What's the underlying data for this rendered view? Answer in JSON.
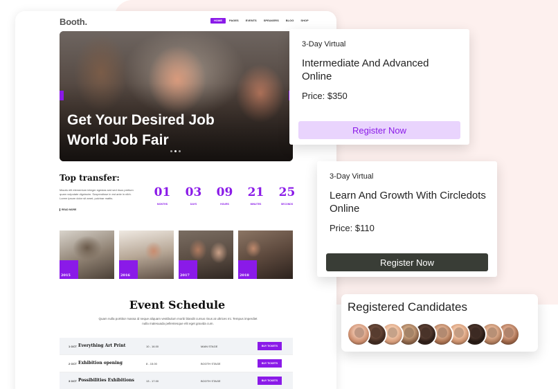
{
  "site": {
    "brand": "Booth.",
    "nav": [
      "HOME",
      "PAGES",
      "EVENTS",
      "SPEAKERS",
      "BLOG",
      "SHOP"
    ],
    "hero_headline": "Get Your Desired Job World Job Fair",
    "transfer_title": "Top transfer:",
    "transfer_text": "Mauris elit elementum integer egestas sed sed risus pretium quam vulputate dignissim. Suspendisse in est ante in nibh. Lorem ipsum dolor sit amet, pulvinar mattis.",
    "read_more": "READ MORE",
    "counters": [
      {
        "value": "01",
        "label": "MONTHS"
      },
      {
        "value": "03",
        "label": "DAYS"
      },
      {
        "value": "09",
        "label": "HOURS"
      },
      {
        "value": "21",
        "label": "MINUTES"
      },
      {
        "value": "25",
        "label": "SECONDS"
      }
    ],
    "gallery_years": [
      "2015",
      "2016",
      "2017",
      "2018"
    ],
    "schedule_title": "Event Schedule",
    "schedule_subtitle": "Quam nulla porttitor massa id neque aliquam vestibulum morbi blandit cursus risus at ultrices mi. Tempus imperdiet nulla malesuada pellentesque elit eget gravida cum.",
    "schedule": [
      {
        "date": "1 OCT",
        "event": "Everything Art Print",
        "time": "10 - 16.00",
        "stage": "MAIN STAGE",
        "button": "BUY TICKETS"
      },
      {
        "date": "2 OCT",
        "event": "Exhibition opening",
        "time": "8 - 15.00",
        "stage": "BOOTH STAGE",
        "button": "BUY TICKETS"
      },
      {
        "date": "3 OCT",
        "event": "Possibilities Exhibitions",
        "time": "13 - 17.00",
        "stage": "BOOTH STAGE",
        "button": "BUY TICKETS"
      }
    ]
  },
  "cards": [
    {
      "kicker": "3-Day Virtual",
      "title": "Intermediate And Advanced Online",
      "price": "Price: $350",
      "button": "Register Now"
    },
    {
      "kicker": "3-Day Virtual",
      "title": "Learn And Growth With Circledots Online",
      "price": "Price: $110",
      "button": "Register Now"
    }
  ],
  "candidates": {
    "title": "Registered Candidates",
    "count": 10
  },
  "colors": {
    "accent": "#8a1ae8",
    "accent_light": "#e9d4fd",
    "dark_button": "#393d36",
    "blob": "#fdf0ee"
  }
}
